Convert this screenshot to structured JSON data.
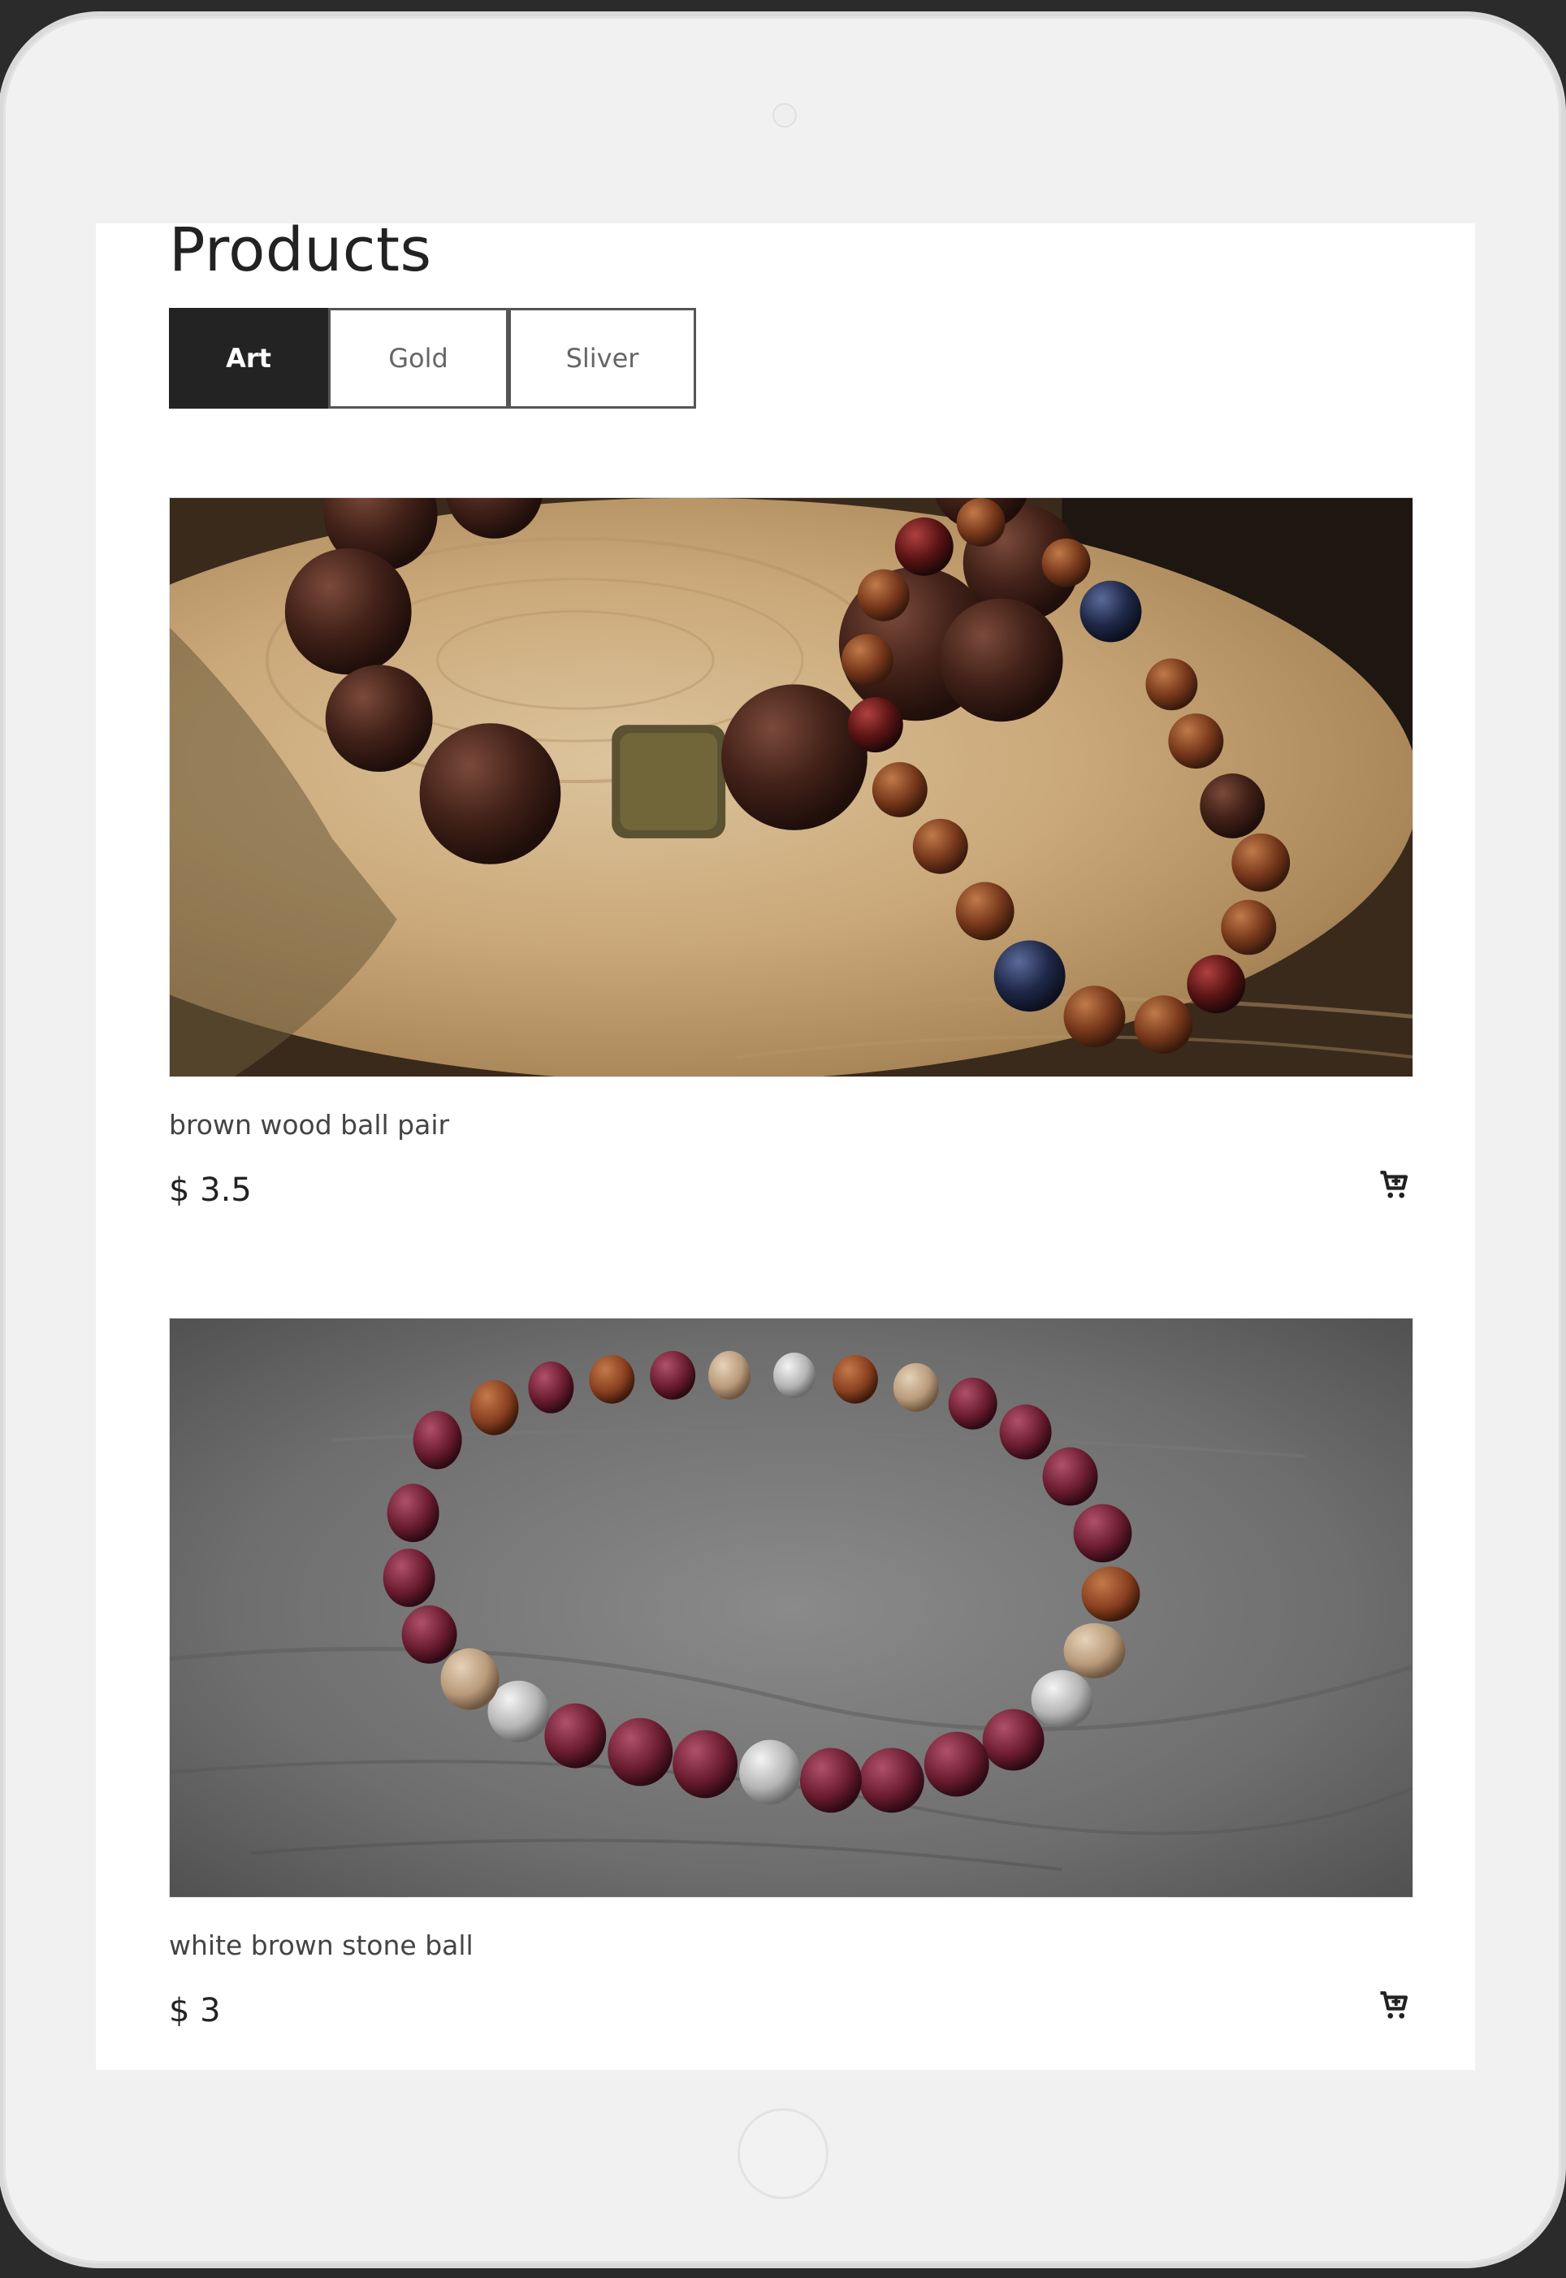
{
  "page": {
    "title": "Products"
  },
  "tabs": [
    {
      "label": "Art",
      "active": true
    },
    {
      "label": "Gold",
      "active": false
    },
    {
      "label": "Sliver",
      "active": false
    }
  ],
  "products": [
    {
      "name": "brown wood ball pair",
      "price": "$ 3.5",
      "image": "wooden-bead-bracelets-on-log-slice",
      "cart_icon": "add-to-cart-icon"
    },
    {
      "name": "white brown stone ball",
      "price": "$ 3",
      "image": "stone-chip-bracelet-on-grey-wood",
      "cart_icon": "add-to-cart-icon"
    }
  ],
  "colors": {
    "active_tab_bg": "#232323",
    "active_tab_text": "#ffffff",
    "tab_border": "#555555",
    "device_frame": "#f1f1f1",
    "screen_bg": "#ffffff"
  }
}
